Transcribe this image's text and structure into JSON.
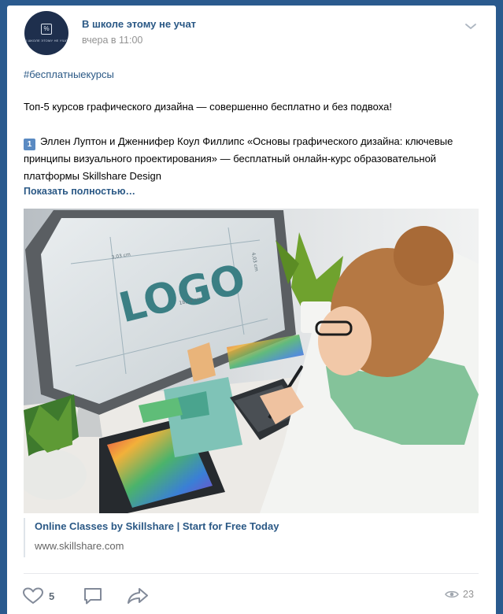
{
  "post": {
    "author": "В школе этому не учат",
    "avatar_text": "В школе этому не учат",
    "avatar_mark": "%",
    "date": "вчера в 11:00",
    "hashtag": "#бесплатныекурсы",
    "intro": "Топ-5 курсов графического дизайна — совершенно бесплатно и без подвоха!",
    "item_number": "1",
    "item_text": "Эллен Луптон и Дженнифер Коул Филлипс «Основы графического дизайна: ключевые принципы визуального проектирования» — бесплатный онлайн-курс образовательной платформы Skillshare Design",
    "show_more": "Показать полностью…",
    "photo": {
      "screen_text": "LOGO",
      "dim_w": "3,03 cm",
      "dim_h": "18,73 cm",
      "dim_side": "4,03 cm"
    },
    "link": {
      "title": "Online Classes by Skillshare | Start for Free Today",
      "url": "www.skillshare.com"
    },
    "footer": {
      "likes": "5",
      "views": "23"
    }
  },
  "colors": {
    "page_background": "#2a5a8e",
    "link": "#2a5885",
    "muted": "#939393",
    "icon": "#828a99"
  }
}
